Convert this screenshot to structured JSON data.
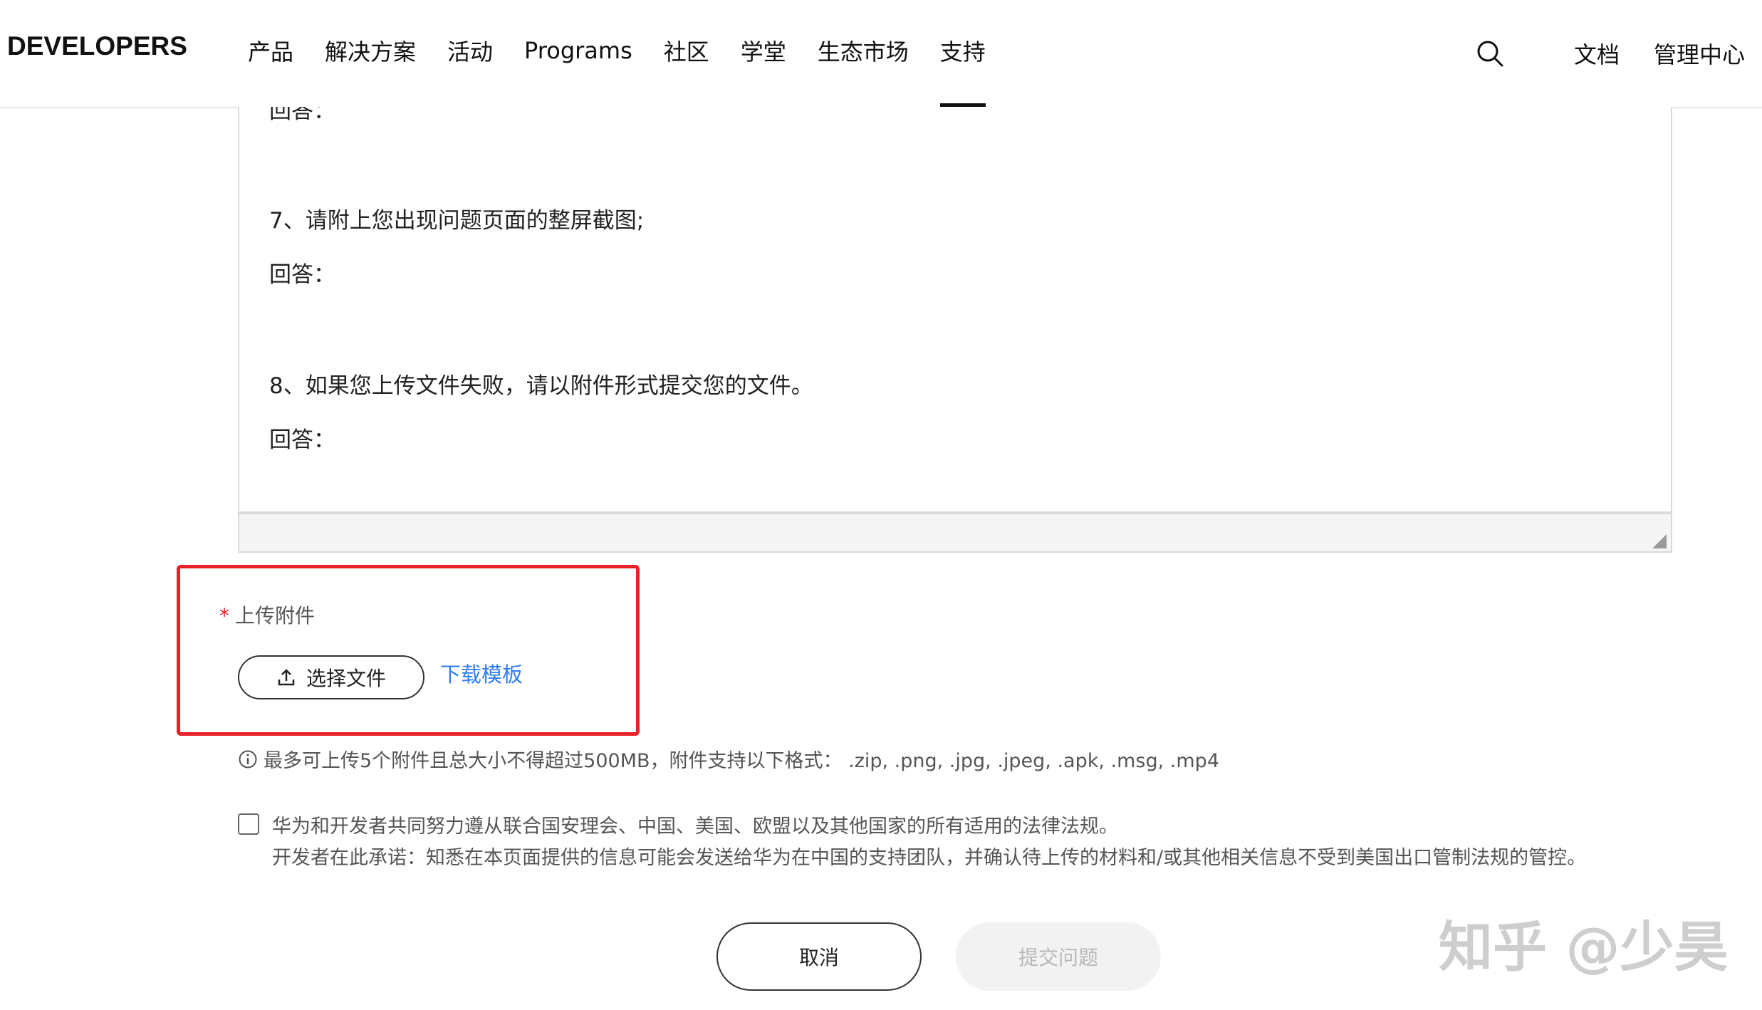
{
  "header": {
    "logo": "DEVELOPERS",
    "nav": [
      {
        "label": "产品"
      },
      {
        "label": "解决方案"
      },
      {
        "label": "活动"
      },
      {
        "label": "Programs"
      },
      {
        "label": "社区"
      },
      {
        "label": "学堂"
      },
      {
        "label": "生态市场"
      },
      {
        "label": "支持",
        "active": true
      }
    ],
    "search_icon": "search-icon",
    "docs_link": "文档",
    "console_link": "管理中心"
  },
  "editor": {
    "partial_answer": "回答：",
    "q7": "7、请附上您出现问题页面的整屏截图;",
    "a7": "回答：",
    "q8": "8、如果您上传文件失败，请以附件形式提交您的文件。",
    "a8": "回答："
  },
  "upload": {
    "required_mark": "*",
    "label": "上传附件",
    "choose_button": "选择文件",
    "download_template": "下载模板",
    "info_icon": "info-icon",
    "info_text": "最多可上传5个附件且总大小不得超过500MB，附件支持以下格式： .zip, .png, .jpg, .jpeg, .apk, .msg, .mp4"
  },
  "agreement": {
    "checked": false,
    "line1": "华为和开发者共同努力遵从联合国安理会、中国、美国、欧盟以及其他国家的所有适用的法律法规。",
    "line2": "开发者在此承诺：知悉在本页面提供的信息可能会发送给华为在中国的支持团队，并确认待上传的材料和/或其他相关信息不受到美国出口管制法规的管控。"
  },
  "actions": {
    "cancel": "取消",
    "submit": "提交问题"
  },
  "watermark": "知乎 @少昊",
  "colors": {
    "highlight": "#e8202a",
    "link": "#2f7ef0",
    "disabled_bg": "#f2f2f2"
  }
}
